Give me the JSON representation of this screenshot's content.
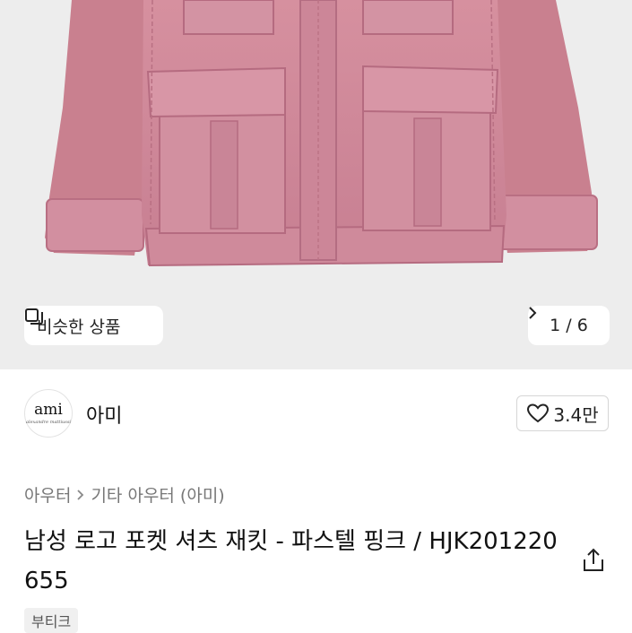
{
  "gallery": {
    "similar_label": "비슷한 상품",
    "similar_icon": "similar-items-icon",
    "counter_current": "1",
    "counter_sep": "/",
    "counter_total": "6",
    "counter_next_icon": "chevron-right-icon"
  },
  "brand": {
    "logo_word": "ami",
    "logo_sub": "alexandre mattiussi",
    "name": "아미",
    "like_icon": "heart-icon",
    "like_count": "3.4만"
  },
  "breadcrumb": {
    "category": "아우터",
    "separator_icon": "chevron-right-icon",
    "subcategory": "기타 아우터 (아미)"
  },
  "product": {
    "title": "남성 로고 포켓 셔츠 재킷 - 파스텔 핑크 / HJK201220655",
    "share_icon": "share-icon",
    "tag": "부티크"
  },
  "colors": {
    "gallery_bg": "#ededed",
    "jacket": "#cf8a9c"
  }
}
